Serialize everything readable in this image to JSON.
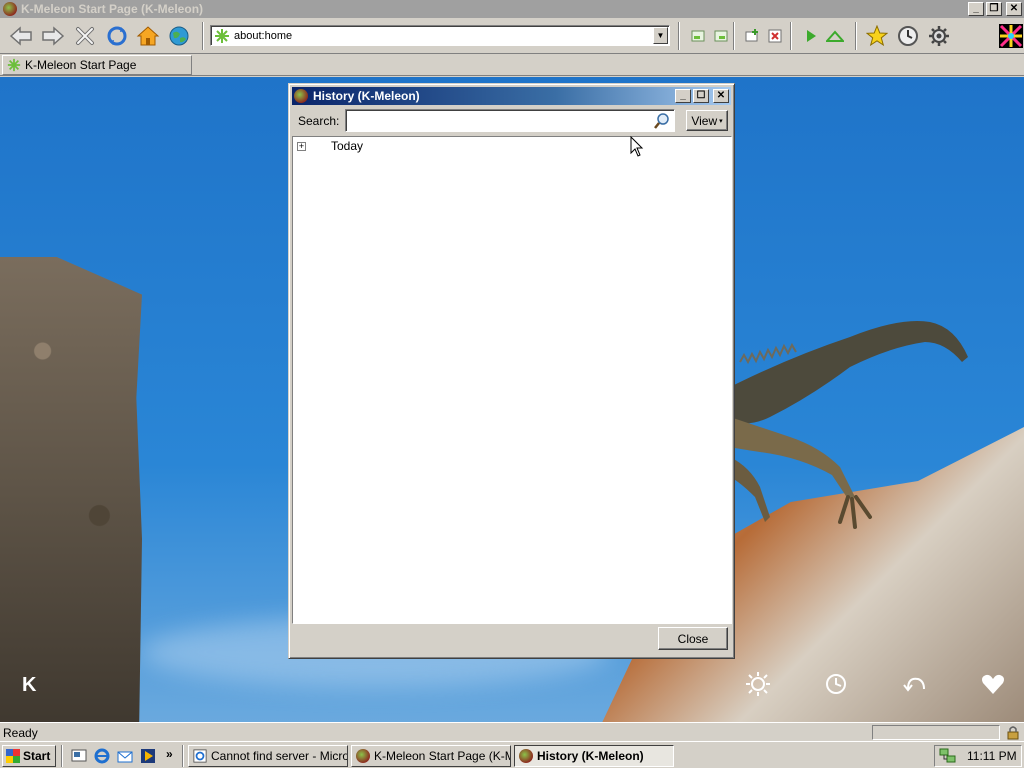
{
  "window": {
    "title": "K-Meleon Start Page (K-Meleon)",
    "controls": {
      "minimize": "_",
      "restore": "❐",
      "close": "✕"
    }
  },
  "toolbar": {
    "icons": [
      "back-icon",
      "forward-icon",
      "stop-icon",
      "reload-icon",
      "home-icon",
      "globe-icon",
      "layers-icon",
      "layers-alt-icon",
      "add-page-icon",
      "close-page-icon",
      "play-icon",
      "up-icon",
      "bookmark-star-icon",
      "history-clock-icon",
      "settings-gear-icon",
      "kmeleon-logo-icon"
    ]
  },
  "urlbar": {
    "value": "about:home",
    "dropdown_glyph": "▼"
  },
  "tab": {
    "label": "K-Meleon Start Page"
  },
  "page": {
    "corner_letter": "K",
    "overlay_icons": [
      "brightness-icon",
      "history-icon",
      "undo-icon",
      "heart-icon"
    ]
  },
  "history_dialog": {
    "title": "History (K-Meleon)",
    "search_label": "Search:",
    "search_value": "",
    "view_button": "View",
    "view_caret": "▾",
    "tree": [
      {
        "label": "Today",
        "expander": "+"
      }
    ],
    "close_button": "Close"
  },
  "statusbar": {
    "text": "Ready"
  },
  "taskbar": {
    "start_label": "Start",
    "quicklaunch_more": "»",
    "tasks": [
      {
        "label": "Cannot find server - Micros...",
        "active": false
      },
      {
        "label": "K-Meleon Start Page (K-M...",
        "active": false
      },
      {
        "label": "History (K-Meleon)",
        "active": true
      }
    ],
    "clock": "11:11 PM"
  },
  "colors": {
    "dialog_title_start": "#0a246a",
    "dialog_title_end": "#a6caf0",
    "chrome": "#d4d0c8",
    "inactive_title": "#a0a0a0",
    "sky": "#2a86d6"
  }
}
